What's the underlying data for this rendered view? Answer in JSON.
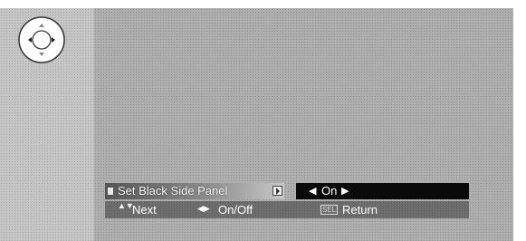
{
  "menu": {
    "item_label": "Set Black Side Panel",
    "value_text": "On",
    "left_arrow": "◀",
    "right_arrow": "▶"
  },
  "help": {
    "updown_icon": "▲▼",
    "next_label": "Next",
    "leftright_icon": "◀▶",
    "onoff_label": "On/Off",
    "sel_icon": "SEL",
    "return_label": "Return"
  },
  "icons": {
    "dpad": "dpad-icon",
    "item": "menu-item-icon",
    "submenu_arrow": "submenu-arrow-icon"
  },
  "colors": {
    "value_box": "#0a0a0a",
    "help_bar": "#6e6e6e",
    "video_area": "#b0b0b0"
  }
}
